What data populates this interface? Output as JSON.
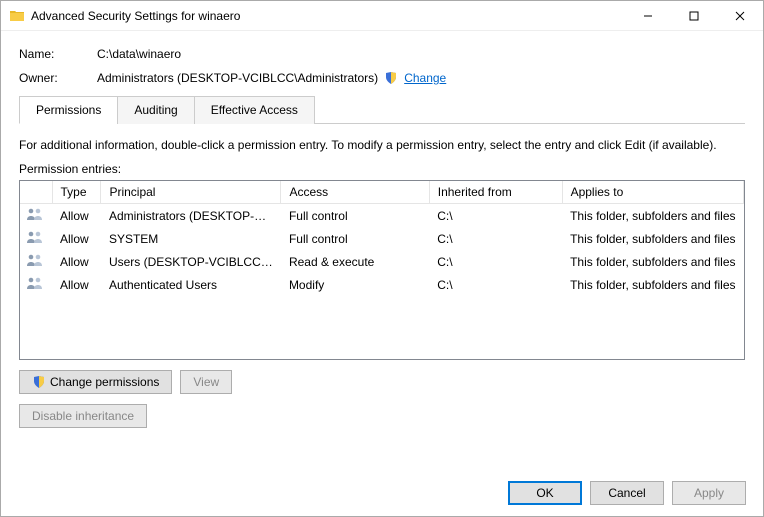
{
  "titlebar": {
    "title": "Advanced Security Settings for winaero"
  },
  "fields": {
    "name_label": "Name:",
    "name_value": "C:\\data\\winaero",
    "owner_label": "Owner:",
    "owner_value": "Administrators (DESKTOP-VCIBLCC\\Administrators)",
    "change_link": "Change"
  },
  "tabs": {
    "permissions": "Permissions",
    "auditing": "Auditing",
    "effective_access": "Effective Access"
  },
  "info_text": "For additional information, double-click a permission entry. To modify a permission entry, select the entry and click Edit (if available).",
  "entries_label": "Permission entries:",
  "columns": {
    "type": "Type",
    "principal": "Principal",
    "access": "Access",
    "inherited": "Inherited from",
    "applies": "Applies to"
  },
  "entries": [
    {
      "type": "Allow",
      "principal": "Administrators (DESKTOP-VCI...",
      "access": "Full control",
      "inherited": "C:\\",
      "applies": "This folder, subfolders and files"
    },
    {
      "type": "Allow",
      "principal": "SYSTEM",
      "access": "Full control",
      "inherited": "C:\\",
      "applies": "This folder, subfolders and files"
    },
    {
      "type": "Allow",
      "principal": "Users (DESKTOP-VCIBLCC\\Us...",
      "access": "Read & execute",
      "inherited": "C:\\",
      "applies": "This folder, subfolders and files"
    },
    {
      "type": "Allow",
      "principal": "Authenticated Users",
      "access": "Modify",
      "inherited": "C:\\",
      "applies": "This folder, subfolders and files"
    }
  ],
  "buttons": {
    "change_permissions": "Change permissions",
    "view": "View",
    "disable_inheritance": "Disable inheritance",
    "ok": "OK",
    "cancel": "Cancel",
    "apply": "Apply"
  }
}
